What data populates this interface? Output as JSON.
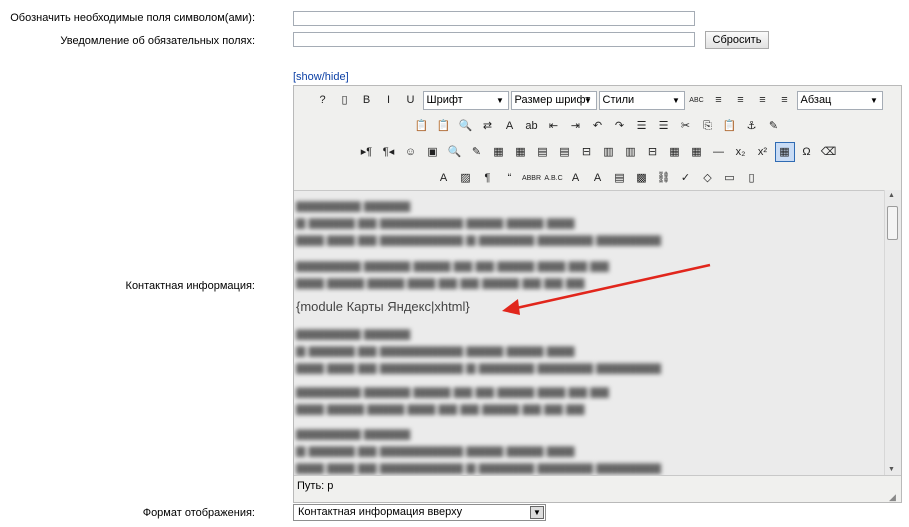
{
  "form": {
    "required_mark_label": "Обозначить необходимые поля символом(ами):",
    "required_notice_label": "Уведомление об обязательных полях:",
    "reset_button": "Сбросить",
    "show_hide": "[show/hide]",
    "contact_info_label": "Контактная информация:",
    "display_format_label": "Формат отображения:",
    "display_format_value": "Контактная информация вверху"
  },
  "editor": {
    "font_select": "Шрифт",
    "size_select": "Размер шрифт",
    "styles_select": "Стили",
    "format_select": "Абзац",
    "module_text": "{module Карты Яндекс|xhtml}",
    "path_label": "Путь:",
    "path_value": "p",
    "icons_row1": [
      {
        "name": "help-icon",
        "glyph": "?"
      },
      {
        "name": "new-document-icon",
        "glyph": "▯"
      },
      {
        "name": "bold-icon",
        "glyph": "B"
      },
      {
        "name": "italic-icon",
        "glyph": "I"
      },
      {
        "name": "underline-icon",
        "glyph": "U"
      }
    ],
    "icons_row1b": [
      {
        "name": "strikethrough-icon",
        "glyph": "ABC"
      },
      {
        "name": "align-left-icon",
        "glyph": "≡"
      },
      {
        "name": "align-center-icon",
        "glyph": "≡"
      },
      {
        "name": "align-right-icon",
        "glyph": "≡"
      },
      {
        "name": "align-justify-icon",
        "glyph": "≡"
      }
    ],
    "icons_row2": [
      {
        "name": "paste-text-icon",
        "glyph": "📋"
      },
      {
        "name": "paste-word-icon",
        "glyph": "📋"
      },
      {
        "name": "find-icon",
        "glyph": "🔍"
      },
      {
        "name": "replace-icon",
        "glyph": "⇄"
      },
      {
        "name": "font-color-icon",
        "glyph": "A"
      },
      {
        "name": "background-color-icon",
        "glyph": "ab"
      },
      {
        "name": "outdent-icon",
        "glyph": "⇤"
      },
      {
        "name": "indent-icon",
        "glyph": "⇥"
      },
      {
        "name": "undo-icon",
        "glyph": "↶"
      },
      {
        "name": "redo-icon",
        "glyph": "↷"
      },
      {
        "name": "ordered-list-icon",
        "glyph": "☰"
      },
      {
        "name": "unordered-list-icon",
        "glyph": "☰"
      },
      {
        "name": "cut-icon",
        "glyph": "✂"
      },
      {
        "name": "copy-icon",
        "glyph": "⎘"
      },
      {
        "name": "paste-icon",
        "glyph": "📋"
      },
      {
        "name": "anchor-icon",
        "glyph": "⚓"
      },
      {
        "name": "cleanup-icon",
        "glyph": "✎"
      }
    ],
    "icons_row3": [
      {
        "name": "ltr-icon",
        "glyph": "▸¶"
      },
      {
        "name": "rtl-icon",
        "glyph": "¶◂"
      },
      {
        "name": "emotions-icon",
        "glyph": "☺"
      },
      {
        "name": "media-icon",
        "glyph": "▣"
      },
      {
        "name": "preview-icon",
        "glyph": "🔍"
      },
      {
        "name": "edit-image-icon",
        "glyph": "✎"
      },
      {
        "name": "table-row-props-icon",
        "glyph": "▦"
      },
      {
        "name": "table-cell-props-icon",
        "glyph": "▦"
      },
      {
        "name": "insert-row-before-icon",
        "glyph": "▤"
      },
      {
        "name": "insert-row-after-icon",
        "glyph": "▤"
      },
      {
        "name": "delete-row-icon",
        "glyph": "⊟"
      },
      {
        "name": "insert-col-before-icon",
        "glyph": "▥"
      },
      {
        "name": "insert-col-after-icon",
        "glyph": "▥"
      },
      {
        "name": "delete-col-icon",
        "glyph": "⊟"
      },
      {
        "name": "split-cells-icon",
        "glyph": "▦"
      },
      {
        "name": "merge-cells-icon",
        "glyph": "▦"
      },
      {
        "name": "horizontal-rule-icon",
        "glyph": "—"
      },
      {
        "name": "subscript-icon",
        "glyph": "x₂"
      },
      {
        "name": "superscript-icon",
        "glyph": "x²"
      },
      {
        "name": "table-icon",
        "glyph": "▦"
      },
      {
        "name": "special-char-icon",
        "glyph": "Ω"
      },
      {
        "name": "eraser-icon",
        "glyph": "⌫"
      }
    ],
    "icons_row4": [
      {
        "name": "styleprops-icon",
        "glyph": "A"
      },
      {
        "name": "template-icon",
        "glyph": "▨"
      },
      {
        "name": "visual-chars-icon",
        "glyph": "¶"
      },
      {
        "name": "cite-icon",
        "glyph": "“"
      },
      {
        "name": "abbr-icon",
        "glyph": "ABBR"
      },
      {
        "name": "acronym-icon",
        "glyph": "A.B.C"
      },
      {
        "name": "del-icon",
        "glyph": "A"
      },
      {
        "name": "ins-icon",
        "glyph": "A"
      },
      {
        "name": "attribs-icon",
        "glyph": "▤"
      },
      {
        "name": "image-icon",
        "glyph": "▩"
      },
      {
        "name": "link-icon",
        "glyph": "⛓"
      },
      {
        "name": "spellcheck-icon",
        "glyph": "✓"
      },
      {
        "name": "code-icon",
        "glyph": "◇"
      },
      {
        "name": "fullscreen-icon",
        "glyph": "▭"
      },
      {
        "name": "layer-icon",
        "glyph": "▯"
      }
    ]
  }
}
